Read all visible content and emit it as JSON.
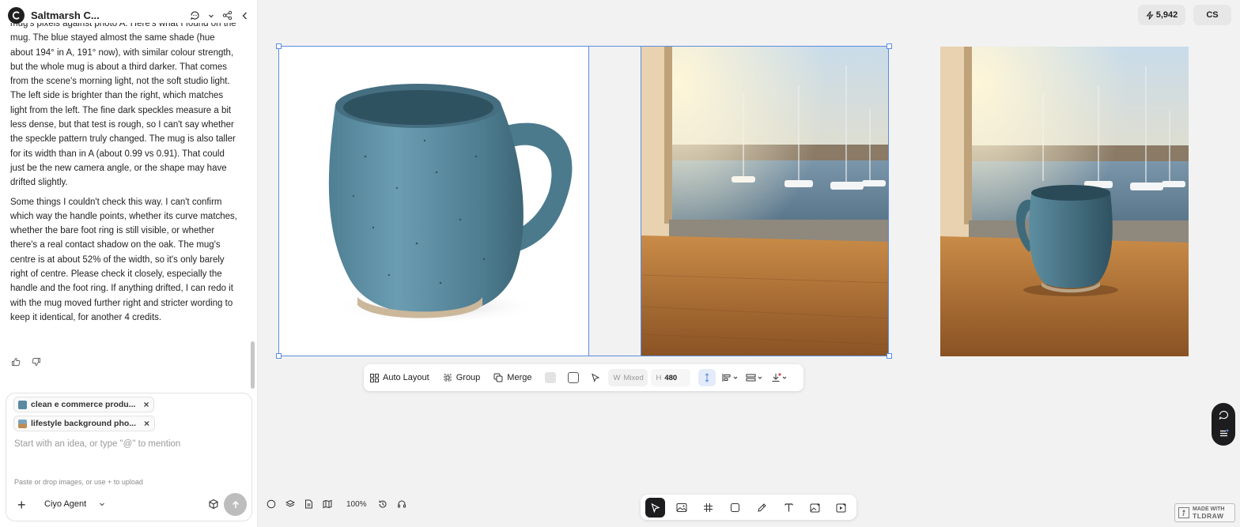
{
  "header": {
    "project_title": "Saltmarsh C..."
  },
  "conversation": {
    "paragraphs": [
      "mug's pixels against photo A. Here's what I found on the mug. The blue stayed almost the same shade (hue about 194° in A, 191° now), with similar colour strength, but the whole mug is about a third darker. That comes from the scene's morning light, not the soft studio light. The left side is brighter than the right, which matches light from the left. The fine dark speckles measure a bit less dense, but that test is rough, so I can't say whether the speckle pattern truly changed. The mug is also taller for its width than in A (about 0.99 vs 0.91). That could just be the new camera angle, or the shape may have drifted slightly.",
      "Some things I couldn't check this way. I can't confirm which way the handle points, whether its curve matches, whether the bare foot ring is still visible, or whether there's a real contact shadow on the oak. The mug's centre is at about 52% of the width, so it's only barely right of centre. Please check it closely, especially the handle and the foot ring. If anything drifted, I can redo it with the mug moved further right and stricter wording to keep it identical, for another 4 credits."
    ]
  },
  "composer": {
    "attachments": [
      {
        "label": "clean e commerce produ...",
        "color": "#5b8aa0"
      },
      {
        "label": "lifestyle background pho...",
        "color": "#c08a52"
      }
    ],
    "placeholder": "Start with an idea, or type \"@\" to mention",
    "hint": "Paste or drop images, or use + to upload",
    "agent_label": "Ciyo Agent"
  },
  "top_right": {
    "credits": "5,942",
    "user_initials": "CS"
  },
  "toolbar": {
    "auto_layout": "Auto Layout",
    "group": "Group",
    "merge": "Merge",
    "width_label": "W",
    "width_value": "Mixed",
    "height_label": "H",
    "height_value": "480"
  },
  "bottom": {
    "zoom": "100%"
  },
  "watermark": {
    "line1": "MADE WITH",
    "line2": "TLDRAW"
  },
  "colors": {
    "accent": "#5b8de0",
    "mug_blue": "#5e8fa3",
    "wood": "#b27434"
  }
}
